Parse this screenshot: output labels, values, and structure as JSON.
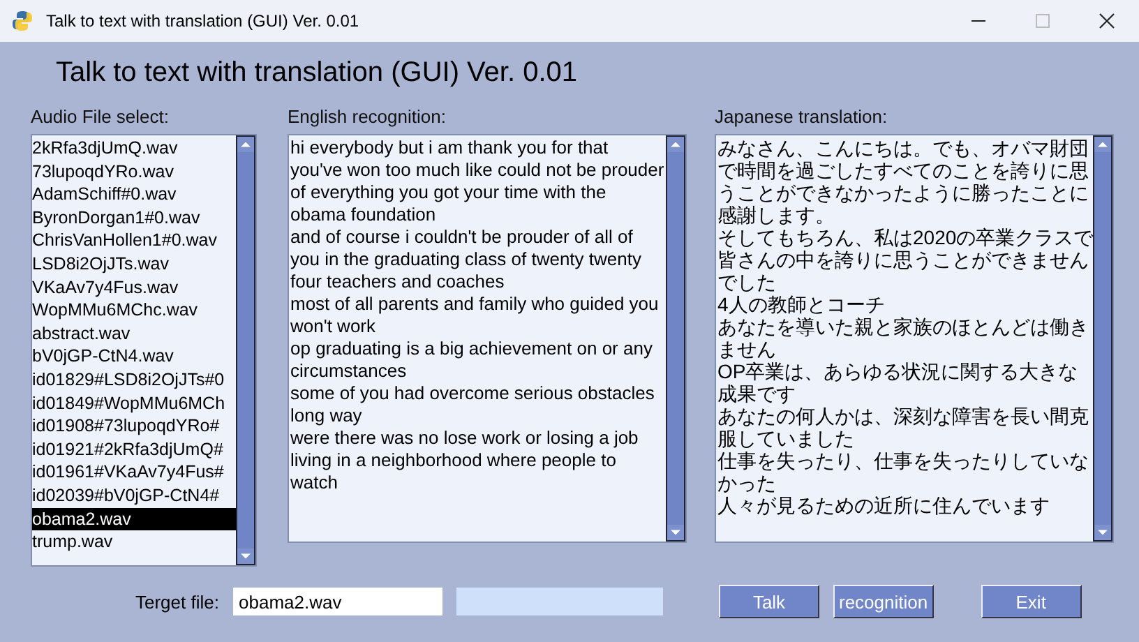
{
  "window": {
    "title": "Talk to text with translation (GUI) Ver. 0.01"
  },
  "heading": "Talk to text with translation (GUI) Ver. 0.01",
  "file_list": {
    "label": "Audio File select:",
    "items": [
      {
        "name": "2kRfa3djUmQ.wav",
        "selected": false
      },
      {
        "name": "73lupoqdYRo.wav",
        "selected": false
      },
      {
        "name": "AdamSchiff#0.wav",
        "selected": false
      },
      {
        "name": "ByronDorgan1#0.wav",
        "selected": false
      },
      {
        "name": "ChrisVanHollen1#0.wav",
        "selected": false
      },
      {
        "name": "LSD8i2OjJTs.wav",
        "selected": false
      },
      {
        "name": "VKaAv7y4Fus.wav",
        "selected": false
      },
      {
        "name": "WopMMu6MChc.wav",
        "selected": false
      },
      {
        "name": "abstract.wav",
        "selected": false
      },
      {
        "name": "bV0jGP-CtN4.wav",
        "selected": false
      },
      {
        "name": "id01829#LSD8i2OjJTs#0",
        "selected": false
      },
      {
        "name": "id01849#WopMMu6MCh",
        "selected": false
      },
      {
        "name": "id01908#73lupoqdYRo#",
        "selected": false
      },
      {
        "name": "id01921#2kRfa3djUmQ#",
        "selected": false
      },
      {
        "name": "id01961#VKaAv7y4Fus#",
        "selected": false
      },
      {
        "name": "id02039#bV0jGP-CtN4#",
        "selected": false
      },
      {
        "name": "obama2.wav",
        "selected": true
      },
      {
        "name": "trump.wav",
        "selected": false
      }
    ]
  },
  "english": {
    "label": "English recognition:",
    "lines": [
      "hi everybody but i am thank you for that",
      "you've won too much like could not be prouder",
      "of everything you got your time with the",
      "obama foundation",
      "and of course i couldn't be prouder of all of",
      "you in the graduating class of twenty twenty",
      "four teachers and coaches",
      "most of all parents and family who guided you",
      "won't work",
      "op graduating is a big achievement on or any",
      "circumstances",
      "some of you had overcome serious obstacles",
      "long way",
      "were there was no lose work or losing a job",
      "living in a neighborhood where people to",
      "watch"
    ]
  },
  "japanese": {
    "label": "Japanese translation:",
    "lines": [
      "みなさん、こんにちは。でも、オバマ財団",
      "で時間を過ごしたすべてのことを誇りに思",
      "うことができなかったように勝ったことに",
      "感謝します。",
      "そしてもちろん、私は2020の卒業クラスで",
      "皆さんの中を誇りに思うことができません",
      "でした",
      "4人の教師とコーチ",
      "あなたを導いた親と家族のほとんどは働き",
      "ません",
      "OP卒業は、あらゆる状況に関する大きな",
      "成果です",
      "あなたの何人かは、深刻な障害を長い間克",
      "服していました",
      "仕事を失ったり、仕事を失ったりしていな",
      "かった",
      "人々が見るための近所に住んでいます"
    ]
  },
  "target": {
    "label": "Terget file:",
    "value": "obama2.wav"
  },
  "buttons": [
    "Talk",
    "recognition",
    "Exit"
  ]
}
